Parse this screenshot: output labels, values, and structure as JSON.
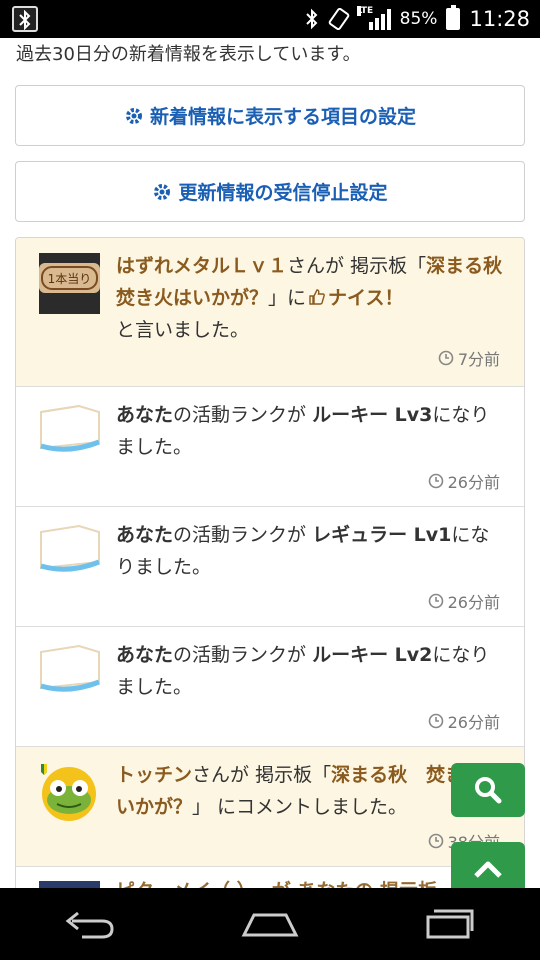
{
  "status_bar": {
    "battery_pct": "85%",
    "time": "11:28",
    "network": "LTE"
  },
  "intro_text": "過去30日分の新着情報を表示しています。",
  "settings": {
    "new_items_label": "新着情報に表示する項目の設定",
    "unsubscribe_label": "更新情報の受信停止設定"
  },
  "feed": [
    {
      "user": "はずれメタルＬｖ１",
      "san_ga": "さんが ",
      "board_label": "掲示板「",
      "thread": "深まる秋　焚き火はいかが？",
      "close_quote": "」に",
      "nice": "ナイス！",
      "tail": "と言いました。",
      "time": "7分前",
      "thumb_text": "1本当り"
    },
    {
      "user": "あなた",
      "mid": "の活動ランクが ",
      "rank": "ルーキー Lv3",
      "tail": "になりました。",
      "time": "26分前"
    },
    {
      "user": "あなた",
      "mid": "の活動ランクが ",
      "rank": "レギュラー Lv1",
      "tail": "になりました。",
      "time": "26分前"
    },
    {
      "user": "あなた",
      "mid": "の活動ランクが ",
      "rank": "ルーキー Lv2",
      "tail": "になりました。",
      "time": "26分前"
    },
    {
      "user": "トッチン",
      "san_ga": "さんが ",
      "board_label": "掲示板「",
      "thread": "深まる秋　焚き火はいかが？",
      "tail": "」 にコメントしました。",
      "time": "38分前"
    },
    {
      "user": "ピク...",
      "partial_text": "ピク　メイ（ ）　 が あなたの 掲示板"
    }
  ],
  "colors": {
    "accent_blue": "#1a5fb4",
    "highlight_bg": "#fcf6e3",
    "fab_green": "#2e9a4a",
    "brown_name": "#8a5a1e"
  }
}
